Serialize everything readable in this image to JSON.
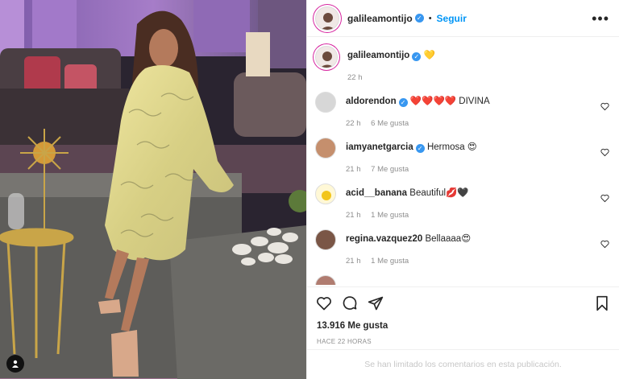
{
  "post": {
    "author": "galileamontijo",
    "follow_label": "Seguir",
    "caption_emoji": "💛",
    "caption_time": "22 h",
    "likes": "13.916 Me gusta",
    "posted_ago": "HACE 22 HORAS",
    "comments_limited": "Se han limitado los comentarios en esta publicación."
  },
  "comments": [
    {
      "user": "aldorendon",
      "verified": "✓",
      "text": "❤️❤️❤️❤️ DIVINA",
      "time": "22 h",
      "likes": "6 Me gusta"
    },
    {
      "user": "iamyanetgarcia",
      "verified": "✓",
      "text": "Hermosa 😍",
      "time": "21 h",
      "likes": "7 Me gusta"
    },
    {
      "user": "acid__banana",
      "text": "Beautiful💋🖤",
      "time": "21 h",
      "likes": "1 Me gusta"
    },
    {
      "user": "regina.vazquez20",
      "text": "Bellaaaa😍",
      "time": "21 h",
      "likes": "1 Me gusta"
    }
  ],
  "colors": {
    "accent": "#0095f6",
    "verified": "#3897f0",
    "muted": "#8e8e8e"
  },
  "icons": [
    "heart-icon",
    "comment-icon",
    "share-icon",
    "bookmark-icon",
    "more-icon",
    "user-tag-icon"
  ]
}
